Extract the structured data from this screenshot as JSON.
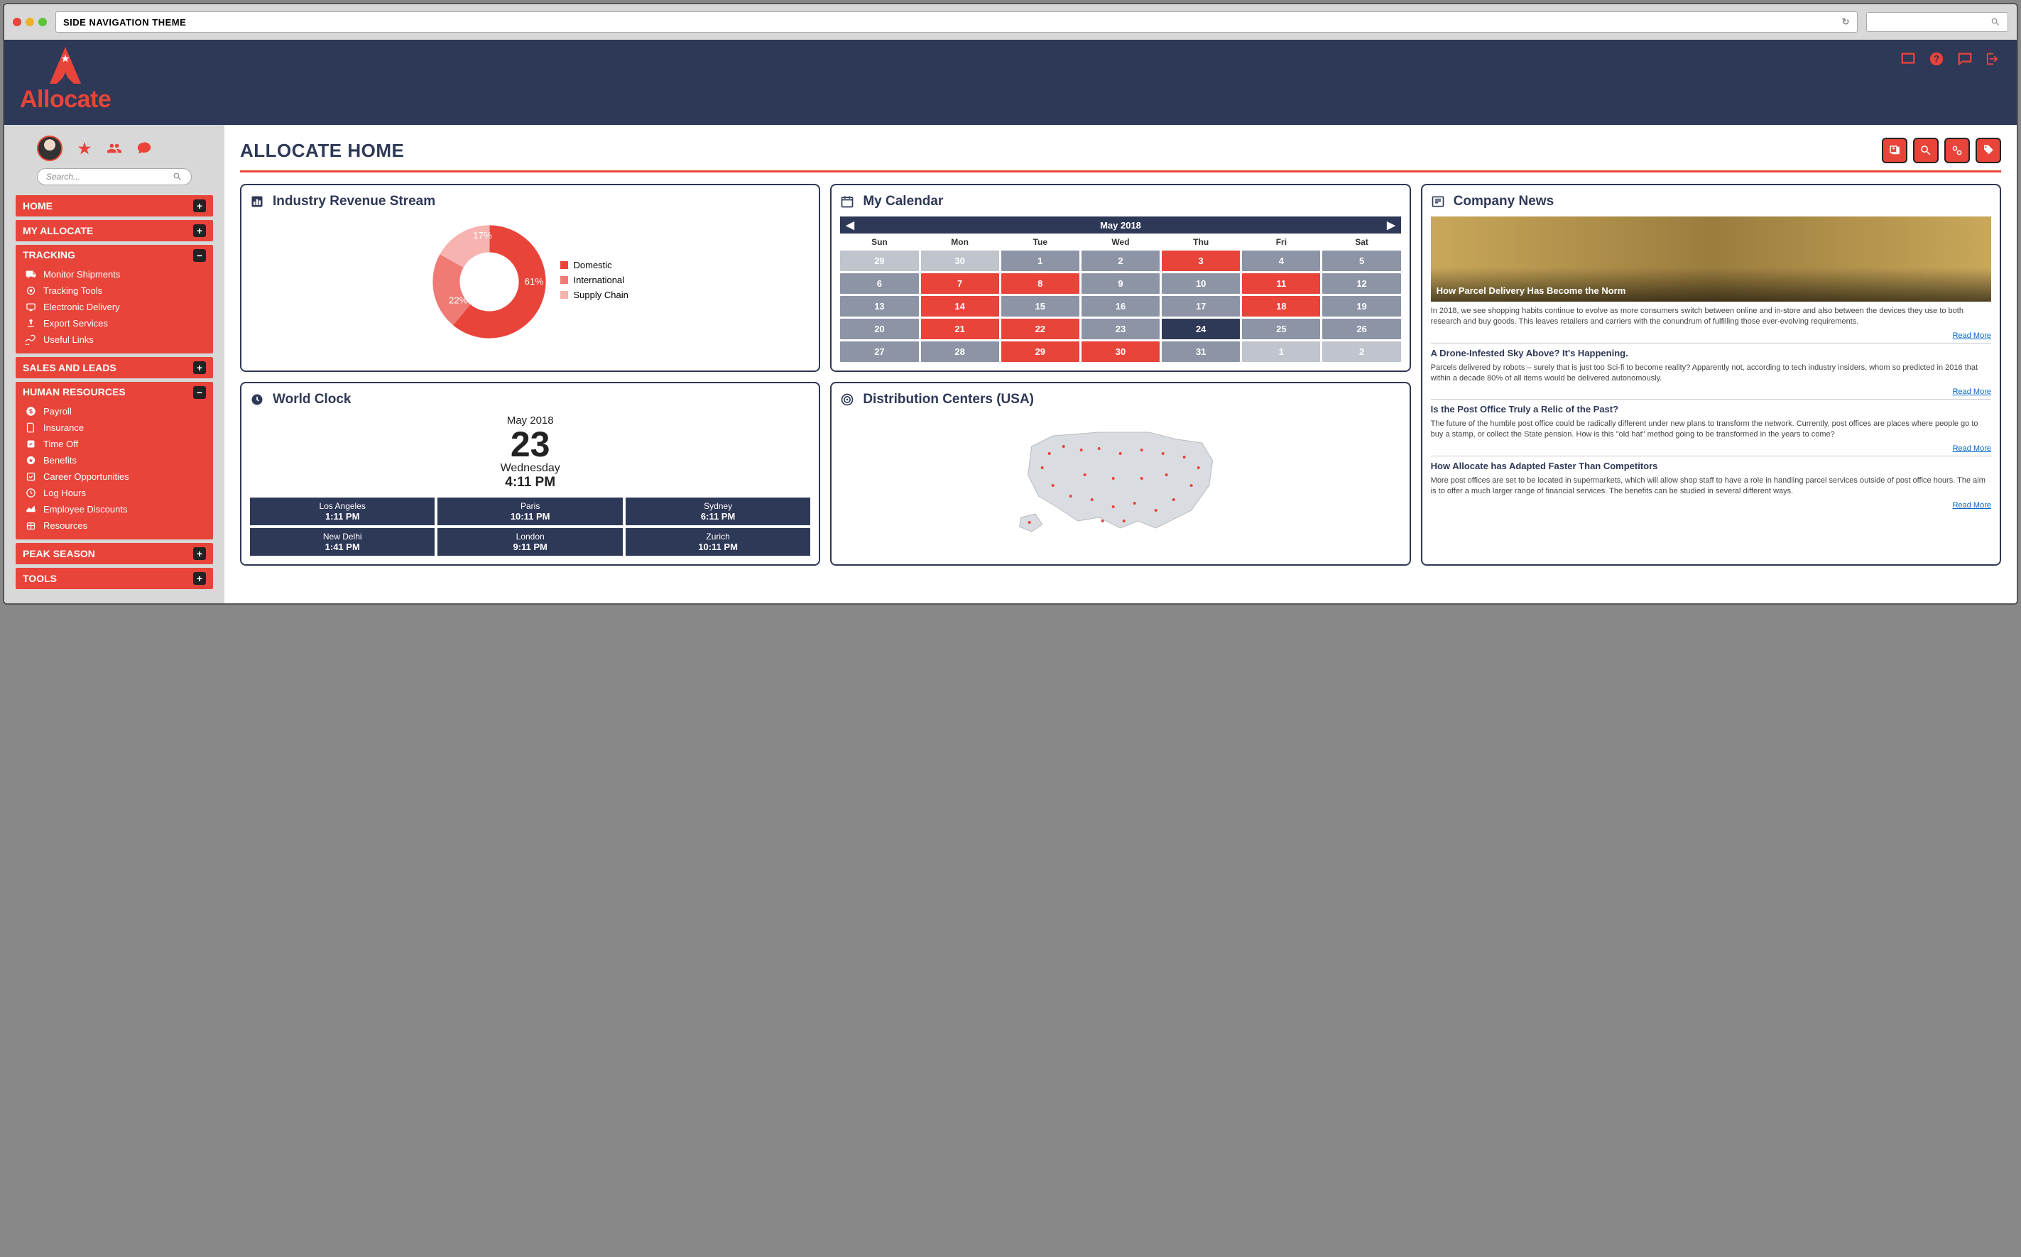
{
  "browser": {
    "urlbar_text": "SIDE NAVIGATION THEME"
  },
  "brand": "Allocate",
  "sidebar": {
    "search_placeholder": "Search...",
    "items": [
      {
        "label": "HOME",
        "badge": "+"
      },
      {
        "label": "MY ALLOCATE",
        "badge": "+"
      }
    ],
    "tracking": {
      "title": "TRACKING",
      "badge": "−",
      "children": [
        "Monitor Shipments",
        "Tracking Tools",
        "Electronic Delivery",
        "Export Services",
        "Useful Links"
      ]
    },
    "sales": {
      "label": "SALES AND LEADS",
      "badge": "+"
    },
    "hr": {
      "title": "HUMAN RESOURCES",
      "badge": "−",
      "children": [
        "Payroll",
        "Insurance",
        "Time Off",
        "Benefits",
        "Career Opportunities",
        "Log Hours",
        "Employee Discounts",
        "Resources"
      ]
    },
    "peak": {
      "label": "PEAK SEASON",
      "badge": "+"
    },
    "tools": {
      "label": "TOOLS",
      "badge": "+"
    }
  },
  "page_title": "ALLOCATE HOME",
  "revenue": {
    "title": "Industry Revenue Stream",
    "legend": [
      "Domestic",
      "International",
      "Supply Chain"
    ]
  },
  "chart_data": {
    "type": "pie",
    "title": "Industry Revenue Stream",
    "series": [
      {
        "name": "Domestic",
        "value": 61,
        "color": "#e8443a"
      },
      {
        "name": "International",
        "value": 22,
        "color": "#ef7b74"
      },
      {
        "name": "Supply Chain",
        "value": 17,
        "color": "#f6b3af"
      }
    ],
    "labels": [
      "61%",
      "22%",
      "17%"
    ]
  },
  "calendar": {
    "title": "My Calendar",
    "month": "May 2018",
    "dow": [
      "Sun",
      "Mon",
      "Tue",
      "Wed",
      "Thu",
      "Fri",
      "Sat"
    ],
    "days": [
      {
        "n": "29",
        "c": "dim"
      },
      {
        "n": "30",
        "c": "dim"
      },
      {
        "n": "1",
        "c": ""
      },
      {
        "n": "2",
        "c": ""
      },
      {
        "n": "3",
        "c": "hl"
      },
      {
        "n": "4",
        "c": ""
      },
      {
        "n": "5",
        "c": ""
      },
      {
        "n": "6",
        "c": ""
      },
      {
        "n": "7",
        "c": "hl"
      },
      {
        "n": "8",
        "c": "hl"
      },
      {
        "n": "9",
        "c": ""
      },
      {
        "n": "10",
        "c": ""
      },
      {
        "n": "11",
        "c": "hl"
      },
      {
        "n": "12",
        "c": ""
      },
      {
        "n": "13",
        "c": ""
      },
      {
        "n": "14",
        "c": "hl"
      },
      {
        "n": "15",
        "c": ""
      },
      {
        "n": "16",
        "c": ""
      },
      {
        "n": "17",
        "c": ""
      },
      {
        "n": "18",
        "c": "hl"
      },
      {
        "n": "19",
        "c": ""
      },
      {
        "n": "20",
        "c": ""
      },
      {
        "n": "21",
        "c": "hl"
      },
      {
        "n": "22",
        "c": "hl"
      },
      {
        "n": "23",
        "c": ""
      },
      {
        "n": "24",
        "c": "today"
      },
      {
        "n": "25",
        "c": ""
      },
      {
        "n": "26",
        "c": ""
      },
      {
        "n": "27",
        "c": ""
      },
      {
        "n": "28",
        "c": ""
      },
      {
        "n": "29",
        "c": "hl"
      },
      {
        "n": "30",
        "c": "hl"
      },
      {
        "n": "31",
        "c": ""
      },
      {
        "n": "1",
        "c": "dim"
      },
      {
        "n": "2",
        "c": "dim"
      }
    ]
  },
  "news": {
    "title": "Company News",
    "featured": {
      "headline": "How Parcel Delivery Has Become the Norm",
      "blurb": "In 2018, we see shopping habits continue to evolve as more consumers switch between online and in-store and also between the devices they use to both research and buy goods. This leaves retailers and carriers with the conundrum of fulfilling those ever-evolving requirements."
    },
    "read_more_label": "Read More",
    "items": [
      {
        "headline": "A Drone-Infested Sky Above? It's Happening.",
        "blurb": "Parcels delivered by robots – surely that is just too Sci-fi to become reality?  Apparently not, according to tech industry insiders, whom so predicted in 2016 that within a decade 80% of all items would be delivered autonomously."
      },
      {
        "headline": "Is the Post Office Truly a Relic of the Past?",
        "blurb": "The future of the humble post office could be radically different under new plans to transform the network. Currently, post offices are places where people go to buy a stamp, or collect the State pension. How is this \"old hat\" method going to be transformed in the years to come?"
      },
      {
        "headline": "How Allocate has Adapted Faster Than Competitors",
        "blurb": "More post offices are set to be located in supermarkets, which will allow shop staff to have a role in handling parcel services outside of post office hours. The aim is to offer a much larger range of financial services. The benefits can be studied in several different ways."
      }
    ]
  },
  "clock": {
    "title": "World Clock",
    "month": "May 2018",
    "day": "23",
    "dow": "Wednesday",
    "time": "4:11 PM",
    "tz": [
      {
        "city": "Los Angeles",
        "time": "1:11 PM"
      },
      {
        "city": "Paris",
        "time": "10:11 PM"
      },
      {
        "city": "Sydney",
        "time": "6:11 PM"
      },
      {
        "city": "New Delhi",
        "time": "1:41 PM"
      },
      {
        "city": "London",
        "time": "9:11 PM"
      },
      {
        "city": "Zurich",
        "time": "10:11 PM"
      }
    ]
  },
  "distribution": {
    "title": "Distribution Centers (USA)"
  }
}
